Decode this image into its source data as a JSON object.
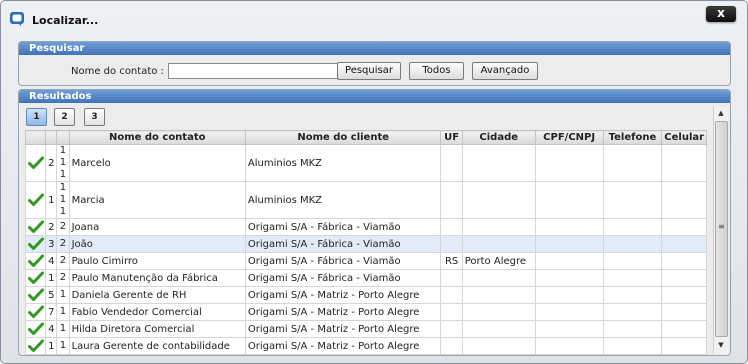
{
  "window": {
    "title": "Localizar...",
    "close_label": "x"
  },
  "search": {
    "header": "Pesquisar",
    "contact_label": "Nome do contato :",
    "contact_value": "",
    "buttons": {
      "search": "Pesquisar",
      "all": "Todos",
      "advanced": "Avançado"
    }
  },
  "results": {
    "header": "Resultados",
    "pages": [
      "1",
      "2",
      "3"
    ],
    "active_page": "1",
    "columns": [
      "",
      "",
      "",
      "Nome do contato",
      "Nome do cliente",
      "UF",
      "Cidade",
      "CPF/CNPJ",
      "Telefone",
      "Celular"
    ],
    "rows": [
      {
        "checked": true,
        "n1": "2",
        "n2": "1\n1\n1",
        "contact": "Marcelo",
        "client": "Aluminios MKZ",
        "uf": "",
        "city": "",
        "cpf": "",
        "phone": "",
        "cell": ""
      },
      {
        "checked": true,
        "n1": "1",
        "n2": "1\n1\n1",
        "contact": "Marcia",
        "client": "Aluminios MKZ",
        "uf": "",
        "city": "",
        "cpf": "",
        "phone": "",
        "cell": ""
      },
      {
        "checked": true,
        "n1": "2",
        "n2": "2",
        "contact": "Joana",
        "client": "Origami S/A - Fábrica - Viamão",
        "uf": "",
        "city": "",
        "cpf": "",
        "phone": "",
        "cell": ""
      },
      {
        "checked": true,
        "n1": "3",
        "n2": "2",
        "contact": "João",
        "client": "Origami S/A - Fábrica - Viamão",
        "uf": "",
        "city": "",
        "cpf": "",
        "phone": "",
        "cell": "",
        "selected": true
      },
      {
        "checked": true,
        "n1": "4",
        "n2": "2",
        "contact": "Paulo Cimirro",
        "client": "Origami S/A - Fábrica - Viamão",
        "uf": "RS",
        "city": "Porto Alegre",
        "cpf": "",
        "phone": "",
        "cell": ""
      },
      {
        "checked": true,
        "n1": "1",
        "n2": "2",
        "contact": "Paulo Manutenção da Fábrica",
        "client": "Origami S/A - Fábrica - Viamão",
        "uf": "",
        "city": "",
        "cpf": "",
        "phone": "",
        "cell": ""
      },
      {
        "checked": true,
        "n1": "5",
        "n2": "1",
        "contact": "Daniela Gerente de RH",
        "client": "Origami S/A - Matriz - Porto Alegre",
        "uf": "",
        "city": "",
        "cpf": "",
        "phone": "",
        "cell": ""
      },
      {
        "checked": true,
        "n1": "7",
        "n2": "1",
        "contact": "Fabio Vendedor Comercial",
        "client": "Origami S/A - Matriz - Porto Alegre",
        "uf": "",
        "city": "",
        "cpf": "",
        "phone": "",
        "cell": ""
      },
      {
        "checked": true,
        "n1": "4",
        "n2": "1",
        "contact": "Hilda Diretora Comercial",
        "client": "Origami S/A - Matriz - Porto Alegre",
        "uf": "",
        "city": "",
        "cpf": "",
        "phone": "",
        "cell": ""
      },
      {
        "checked": true,
        "n1": "1",
        "n2": "1",
        "contact": "Laura Gerente de contabilidade",
        "client": "Origami S/A - Matriz - Porto Alegre",
        "uf": "",
        "city": "",
        "cpf": "",
        "phone": "",
        "cell": ""
      }
    ]
  },
  "colors": {
    "header_blue": "#3f73b8",
    "check_green": "#2e9a1e",
    "selected_row": "#e3ebf8"
  },
  "icons": {
    "title": "search-window-icon",
    "row": "check-icon"
  }
}
